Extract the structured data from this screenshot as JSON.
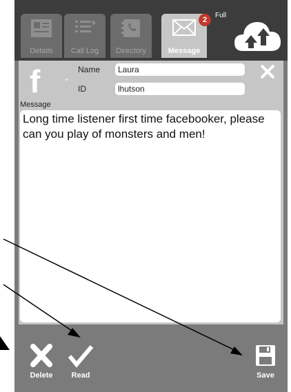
{
  "tabs": [
    {
      "label": "Details",
      "icon": "contact-card-icon"
    },
    {
      "label": "Call Log",
      "icon": "call-log-icon"
    },
    {
      "label": "Directory",
      "icon": "directory-icon"
    },
    {
      "label": "Message",
      "icon": "envelope-icon",
      "active": true
    }
  ],
  "message_badge": "2",
  "status_text": "Full",
  "form": {
    "source_icon": "facebook-icon",
    "name_label": "Name",
    "name_value": "Laura",
    "id_label": "ID",
    "id_value": "lhutson"
  },
  "message": {
    "label": "Message",
    "text": "Long time listener first time facebooker, please can you play of monsters and men!"
  },
  "actions": {
    "delete_label": "Delete",
    "read_label": "Read",
    "save_label": "Save"
  },
  "colors": {
    "panel": "#7b7b7b",
    "header": "#3c3c3c",
    "active_tab": "#c6c6c6",
    "badge": "#c0392b"
  }
}
